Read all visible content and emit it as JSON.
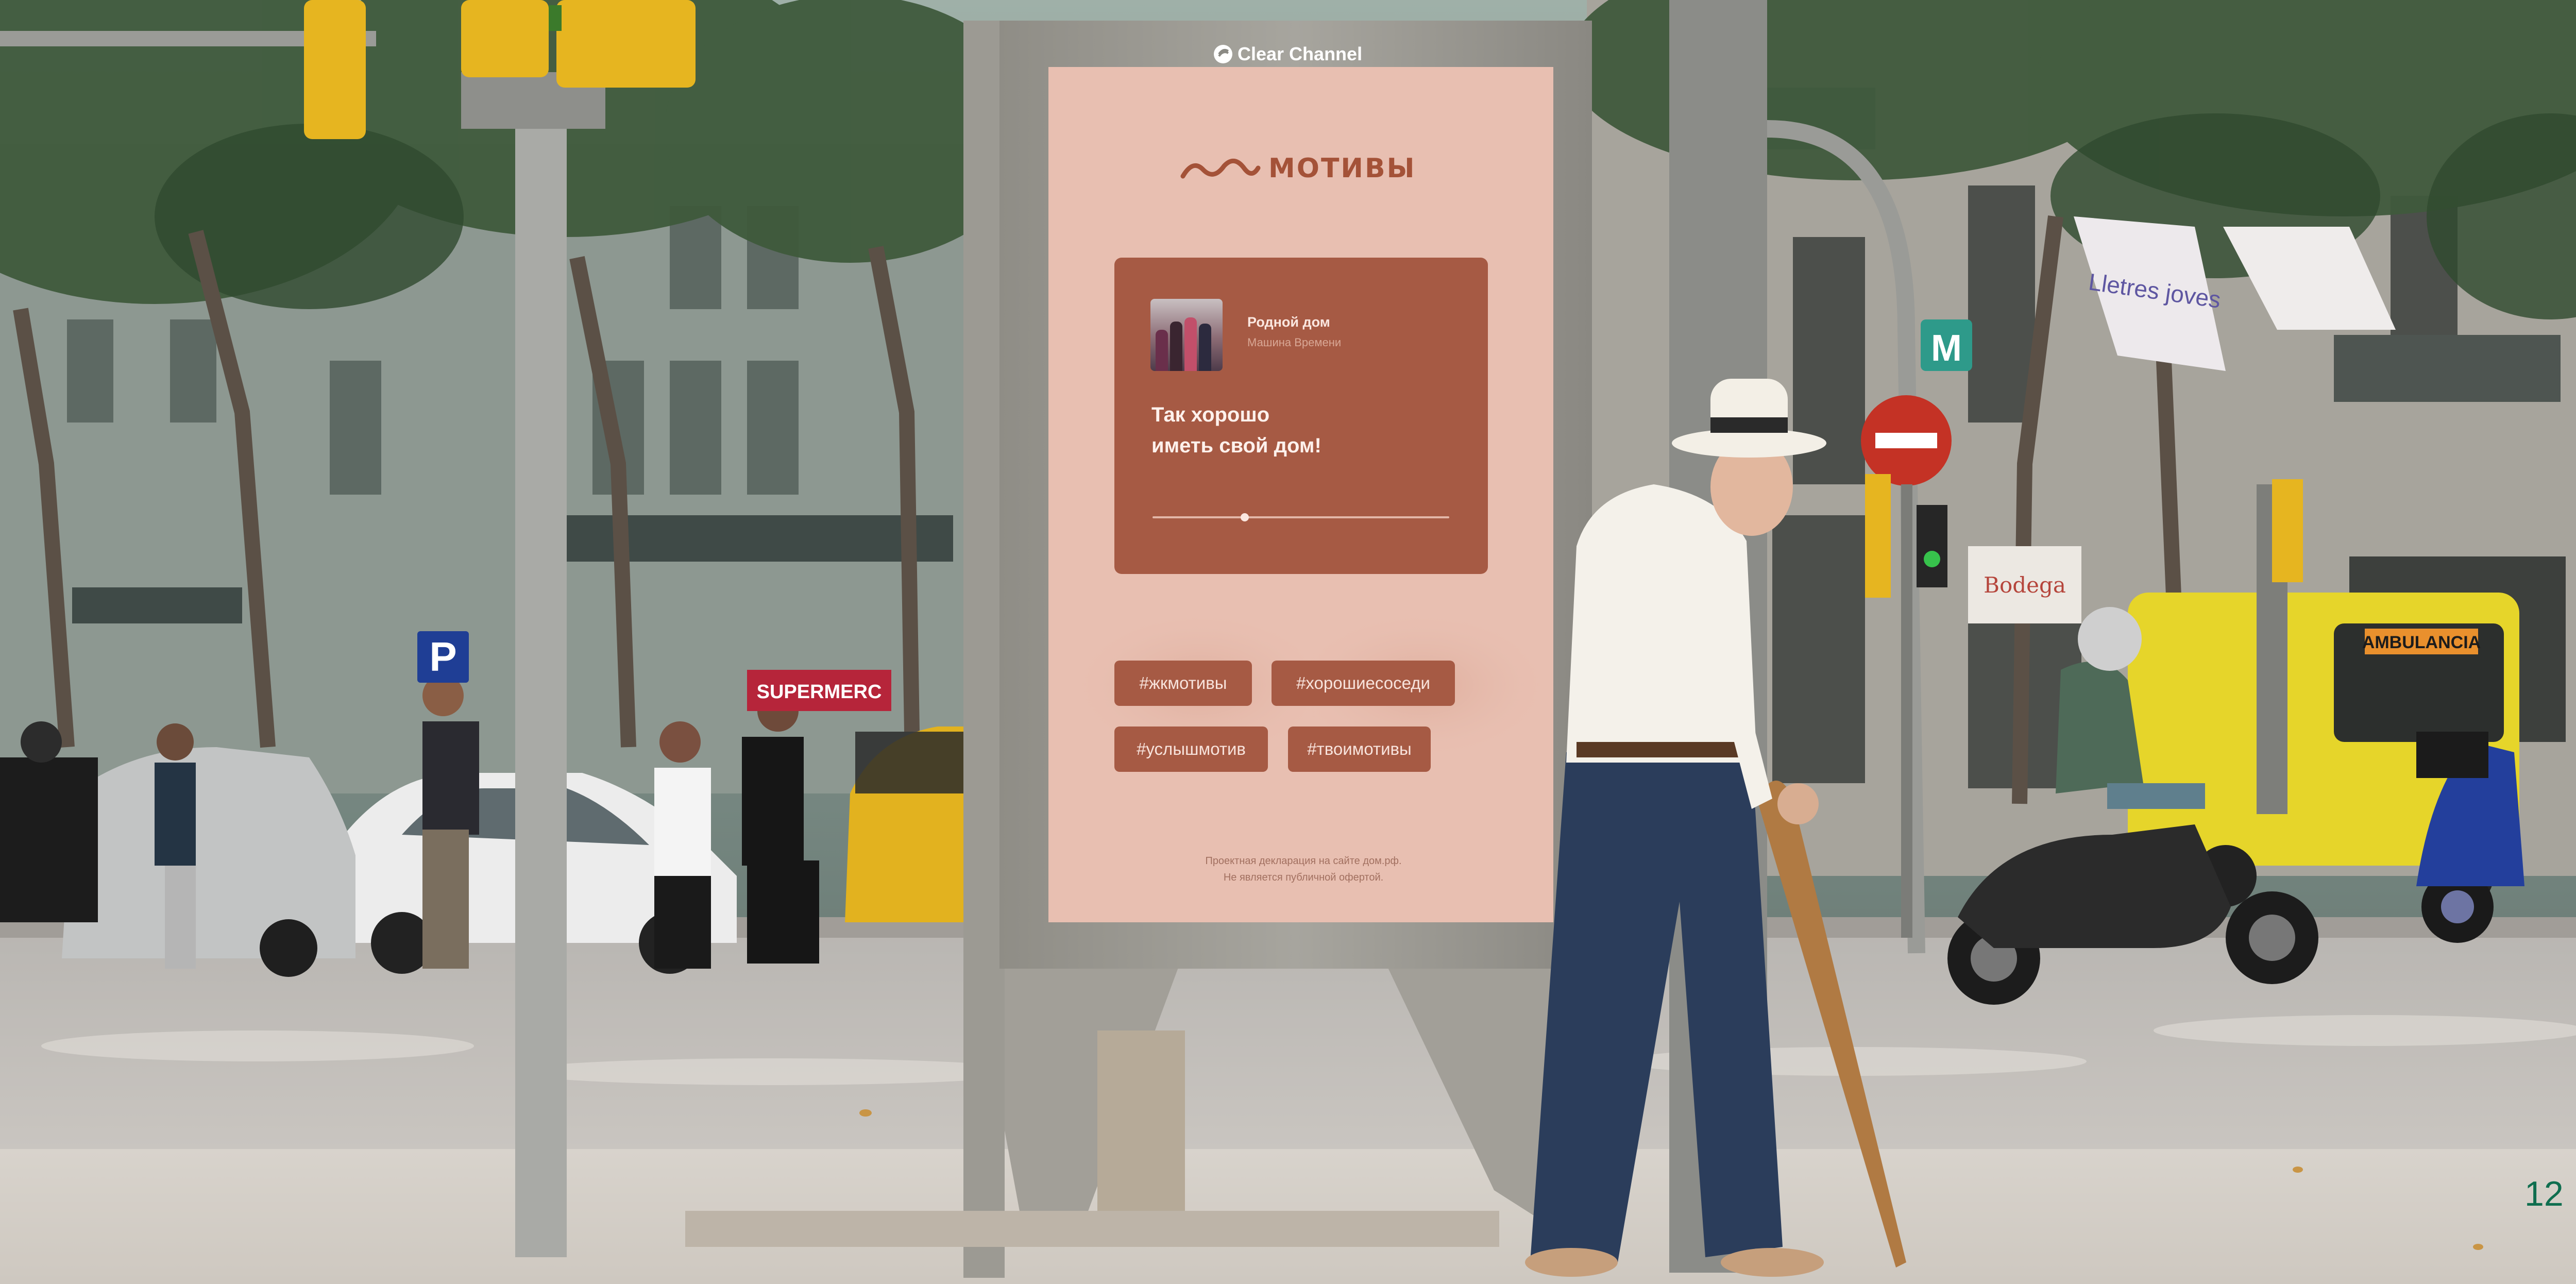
{
  "poster": {
    "operator": "Clear Channel",
    "brand": "МОТИВЫ",
    "player": {
      "track_title": "Родной дом",
      "track_artist": "Машина Времени",
      "message": "Так хорошо\nиметь свой дом!",
      "progress": 0.31
    },
    "hashtags": [
      "#жкмотивы",
      "#хорошиесоседи",
      "#услышмотив",
      "#твоимотивы"
    ],
    "disclaimer": "Проектная декларация на сайте дом.рф.\nНе является публичной офертой."
  },
  "street_signs": {
    "parking": "P",
    "metro": "M",
    "banners": [
      "Lletres joves"
    ],
    "shops": [
      "Bodega",
      "SUPERMERC"
    ]
  },
  "vehicles": {
    "ambulance": "AMBULANCIA"
  },
  "page_number": "12",
  "colors": {
    "poster_background": "#e8bfb1",
    "poster_accent": "#a65a44",
    "page_number": "#0f6e4f"
  }
}
